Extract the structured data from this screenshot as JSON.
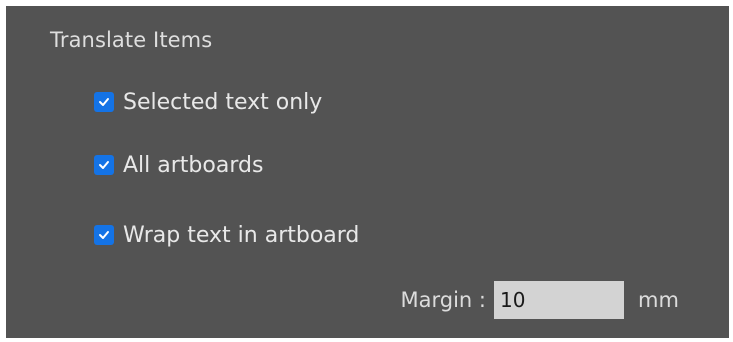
{
  "section": {
    "title": "Translate Items"
  },
  "options": [
    {
      "label": "Selected text only",
      "checked": true
    },
    {
      "label": "All artboards",
      "checked": true
    },
    {
      "label": "Wrap text in artboard",
      "checked": true
    }
  ],
  "margin": {
    "label": "Margin :",
    "value": "10",
    "unit": "mm"
  },
  "colors": {
    "panel_bg": "#535353",
    "checkbox_accent": "#1473e6",
    "input_bg": "#d3d3d3"
  },
  "icons": {
    "checkbox_mark": "checkmark-icon"
  }
}
